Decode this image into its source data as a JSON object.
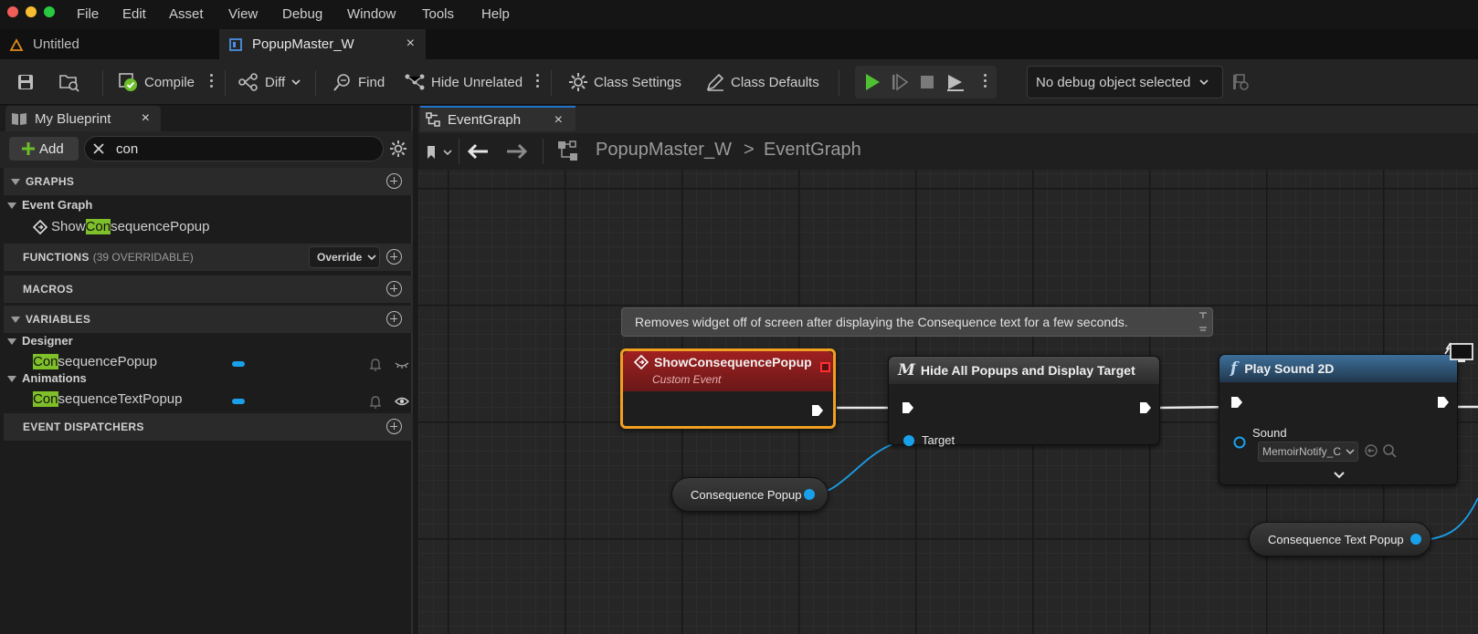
{
  "menubar": {
    "items": [
      "File",
      "Edit",
      "Asset",
      "View",
      "Debug",
      "Window",
      "Tools",
      "Help"
    ]
  },
  "doc_tabs": [
    {
      "label": "Untitled"
    },
    {
      "label": "PopupMaster_W",
      "close": "×"
    }
  ],
  "toolbar": {
    "compile": "Compile",
    "diff": "Diff",
    "find": "Find",
    "hide_unrelated": "Hide Unrelated",
    "class_settings": "Class Settings",
    "class_defaults": "Class Defaults",
    "debug_object": "No debug object selected"
  },
  "left_panel": {
    "tab_title": "My Blueprint",
    "close": "×",
    "add_label": "Add",
    "search_value": "con",
    "graphs_header": "GRAPHS",
    "event_graph_label": "Event Graph",
    "event_item": {
      "pre": "Show",
      "match": "Con",
      "post": "sequencePopup"
    },
    "functions_header": "FUNCTIONS",
    "functions_count": "(39 OVERRIDABLE)",
    "override_label": "Override",
    "macros_header": "MACROS",
    "variables_header": "VARIABLES",
    "designer_label": "Designer",
    "var_item": {
      "match": "Con",
      "post": "sequencePopup"
    },
    "animations_label": "Animations",
    "anim_item": {
      "match": "Con",
      "post": "sequenceTextPopup"
    },
    "dispatchers_header": "EVENT DISPATCHERS"
  },
  "graph_panel": {
    "tab_title": "EventGraph",
    "close": "×",
    "breadcrumb_root": "PopupMaster_W",
    "breadcrumb_sep": ">",
    "breadcrumb_leaf": "EventGraph",
    "comment": "Removes widget off of screen after displaying the Consequence text for a few seconds.",
    "event_node": {
      "title": "ShowConsequencePopup",
      "subtitle": "Custom Event"
    },
    "hide_node": {
      "icon": "M",
      "title": "Hide All Popups and Display Target",
      "pin": "Target"
    },
    "sound_node": {
      "icon": "f",
      "title": "Play Sound 2D",
      "pin": "Sound",
      "value": "MemoirNotify_C"
    },
    "var_consequence_popup": "Consequence Popup",
    "var_consequence_text_popup": "Consequence Text Popup"
  },
  "colors": {
    "accent_green": "#7fbf2a",
    "pin_blue": "#19a0ea",
    "event_red": "#8a1c1c",
    "selected_orange": "#f0a020",
    "tab_blue": "#1f74c9"
  }
}
